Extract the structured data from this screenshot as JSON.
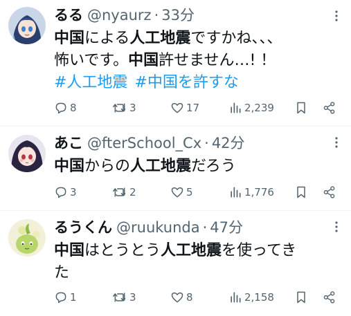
{
  "tweets": [
    {
      "display_name": "るる",
      "handle": "@nyaurz",
      "separator": "·",
      "time": "33分",
      "body_line1": [
        {
          "text": "中国",
          "bold": true
        },
        {
          "text": "による",
          "bold": false
        },
        {
          "text": "人工地震",
          "bold": true
        },
        {
          "text": "ですかね、、、",
          "bold": false
        }
      ],
      "body_line2": [
        {
          "text": "怖いです。",
          "bold": false
        },
        {
          "text": "中国",
          "bold": true
        },
        {
          "text": "許せません…! ！",
          "bold": false
        }
      ],
      "hashtags": [
        "#人工地震",
        "#中国を許すな"
      ],
      "replies": "8",
      "retweets": "3",
      "likes": "17",
      "views": "2,239"
    },
    {
      "display_name": "あこ",
      "handle": "@fterSchool_Cx",
      "separator": "·",
      "time": "42分",
      "body_line1": [
        {
          "text": "中国",
          "bold": true
        },
        {
          "text": "からの",
          "bold": false
        },
        {
          "text": "人工地震",
          "bold": true
        },
        {
          "text": "だろう",
          "bold": false
        }
      ],
      "replies": "3",
      "retweets": "2",
      "likes": "5",
      "views": "1,776"
    },
    {
      "display_name": "るうくん",
      "handle": "@ruukunda",
      "separator": "·",
      "time": "47分",
      "body_line1": [
        {
          "text": "中国",
          "bold": true
        },
        {
          "text": "はとうとう",
          "bold": false
        },
        {
          "text": "人工地震",
          "bold": true
        },
        {
          "text": "を使ってき",
          "bold": false
        }
      ],
      "body_line2": [
        {
          "text": "た",
          "bold": false
        }
      ],
      "replies": "1",
      "retweets": "3",
      "likes": "8",
      "views": "2,158"
    }
  ],
  "colors": {
    "text": "#0f1419",
    "secondary": "#536471",
    "hashtag": "#1d9bf0",
    "divider": "#eff3f4"
  },
  "icons": [
    "reply-icon",
    "retweet-icon",
    "like-icon",
    "views-icon",
    "bookmark-icon",
    "share-icon",
    "more-icon"
  ]
}
